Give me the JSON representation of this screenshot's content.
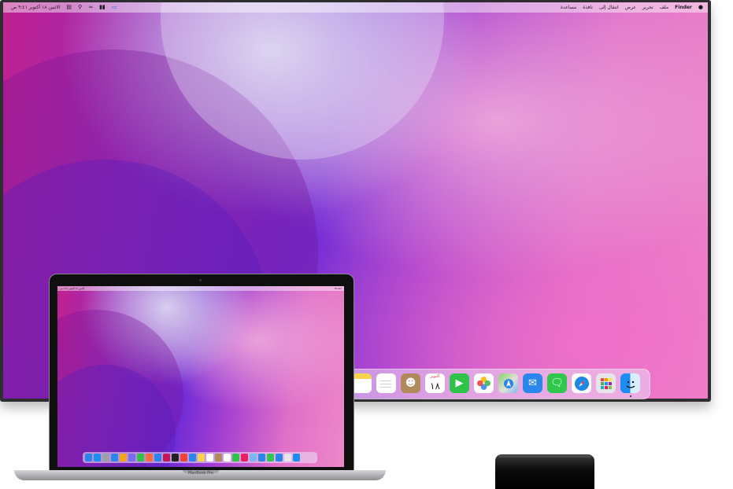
{
  "tv": {
    "menubar": {
      "apple_icon": "apple-logo-icon",
      "app_name": "Finder",
      "menus": [
        "ملف",
        "تحرير",
        "عرض",
        "انتقال إلى",
        "نافذة",
        "مساعدة"
      ],
      "status_icons": [
        "screen-mirroring-icon",
        "battery-icon",
        "wifi-icon",
        "search-icon",
        "control-center-icon"
      ],
      "clock": "الاثنين ١٨ أكتوبر ٩:٤١ ص"
    },
    "dock": {
      "apps": [
        {
          "name": "Notes",
          "icon": "notes-icon"
        },
        {
          "name": "Reminders",
          "icon": "reminders-icon"
        },
        {
          "name": "Contacts",
          "icon": "contacts-icon"
        },
        {
          "name": "Calendar",
          "icon": "calendar-icon",
          "month": "أكتوبر",
          "day": "١٨"
        },
        {
          "name": "FaceTime",
          "icon": "facetime-icon"
        },
        {
          "name": "Photos",
          "icon": "photos-icon"
        },
        {
          "name": "Maps",
          "icon": "maps-icon"
        },
        {
          "name": "Mail",
          "icon": "mail-icon"
        },
        {
          "name": "Messages",
          "icon": "messages-icon"
        },
        {
          "name": "Safari",
          "icon": "safari-icon"
        },
        {
          "name": "Launchpad",
          "icon": "launchpad-icon"
        },
        {
          "name": "Finder",
          "icon": "finder-icon"
        }
      ]
    }
  },
  "macbook": {
    "label": "MacBook Pro",
    "dock_icon_colors": [
      "#2a86ea",
      "#1b8ef3",
      "#9aa0a6",
      "#2a86ea",
      "#f2a51a",
      "#7a6cf0",
      "#2fc34a",
      "#ff6a3d",
      "#2a86ea",
      "#c2185b",
      "#222222",
      "#f44336",
      "#2a86ea",
      "#f8d448",
      "#ffffff",
      "#b08a5a",
      "#ffffff",
      "#2fc34a",
      "#e91e63",
      "#79b8f0",
      "#2a86ea",
      "#2fc84c",
      "#2a86ea",
      "#e6e6ea",
      "#1b8ef3"
    ]
  },
  "apple_tv": {
    "icon": "apple-tv-device"
  }
}
